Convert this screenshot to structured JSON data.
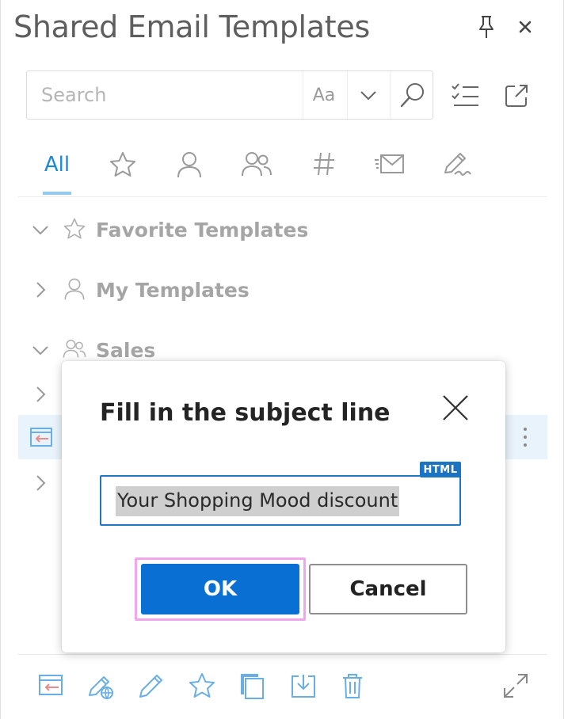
{
  "header": {
    "title": "Shared Email Templates"
  },
  "search": {
    "placeholder": "Search",
    "value": "",
    "match_case_label": "Aa"
  },
  "tabs": [
    {
      "label": "All",
      "icon": "all",
      "selected": true
    },
    {
      "icon": "star-icon"
    },
    {
      "icon": "person-icon"
    },
    {
      "icon": "people-icon"
    },
    {
      "icon": "hash-icon"
    },
    {
      "icon": "mail-icon"
    },
    {
      "icon": "signature-icon"
    }
  ],
  "tree": {
    "items": [
      {
        "label": "Favorite Templates",
        "icon": "star-icon",
        "expanded": true
      },
      {
        "label": "My Templates",
        "icon": "person-icon",
        "expanded": false
      },
      {
        "label": "Sales",
        "icon": "people-icon",
        "expanded": true
      }
    ]
  },
  "dialog": {
    "title": "Fill in the subject line",
    "subject_value": "Your Shopping Mood discount",
    "badge": "HTML",
    "ok_label": "OK",
    "cancel_label": "Cancel"
  },
  "colors": {
    "accent": "#1a8ad8",
    "primary_button": "#0a6fd3",
    "focus_ring": "#f3a4ef",
    "icon_blue": "#6aaee6",
    "selected_row": "#e9f3fb"
  }
}
